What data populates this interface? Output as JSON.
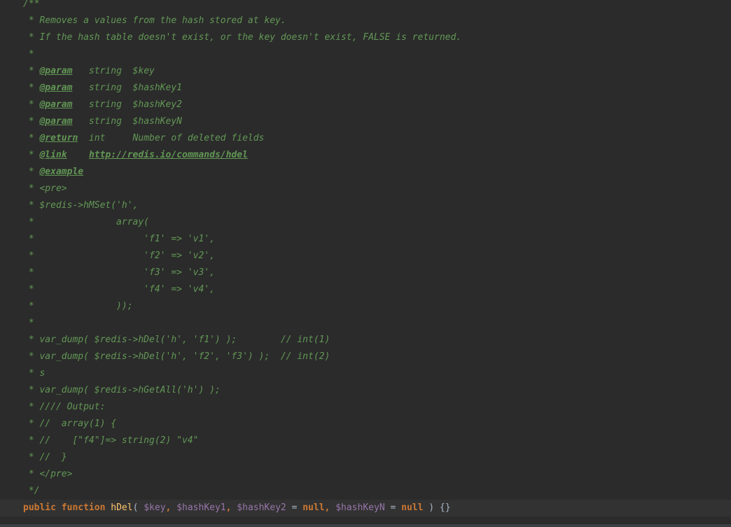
{
  "editor": {
    "lines": [
      [
        {
          "c": "t-comment",
          "t": "/**"
        }
      ],
      [
        {
          "c": "t-comment",
          "t": " * Removes a values from the hash stored at key."
        }
      ],
      [
        {
          "c": "t-comment",
          "t": " * If the hash table doesn't exist, or the key doesn't exist, FALSE is returned."
        }
      ],
      [
        {
          "c": "t-comment",
          "t": " *"
        }
      ],
      [
        {
          "c": "t-comment",
          "t": " * "
        },
        {
          "c": "t-tag",
          "t": "@param"
        },
        {
          "c": "t-comment",
          "t": "   string  $key"
        }
      ],
      [
        {
          "c": "t-comment",
          "t": " * "
        },
        {
          "c": "t-tag",
          "t": "@param"
        },
        {
          "c": "t-comment",
          "t": "   string  $hashKey1"
        }
      ],
      [
        {
          "c": "t-comment",
          "t": " * "
        },
        {
          "c": "t-tag",
          "t": "@param"
        },
        {
          "c": "t-comment",
          "t": "   string  $hashKey2"
        }
      ],
      [
        {
          "c": "t-comment",
          "t": " * "
        },
        {
          "c": "t-tag",
          "t": "@param"
        },
        {
          "c": "t-comment",
          "t": "   string  $hashKeyN"
        }
      ],
      [
        {
          "c": "t-comment",
          "t": " * "
        },
        {
          "c": "t-tag",
          "t": "@return"
        },
        {
          "c": "t-comment",
          "t": "  int     Number of deleted fields"
        }
      ],
      [
        {
          "c": "t-comment",
          "t": " * "
        },
        {
          "c": "t-tag",
          "t": "@link"
        },
        {
          "c": "t-comment",
          "t": "    "
        },
        {
          "c": "t-link",
          "t": "http://redis.io/commands/hdel"
        }
      ],
      [
        {
          "c": "t-comment",
          "t": " * "
        },
        {
          "c": "t-tag",
          "t": "@example"
        }
      ],
      [
        {
          "c": "t-comment",
          "t": " * <pre>"
        }
      ],
      [
        {
          "c": "t-comment",
          "t": " * $redis->hMSet('h',"
        }
      ],
      [
        {
          "c": "t-comment",
          "t": " *               array("
        }
      ],
      [
        {
          "c": "t-comment",
          "t": " *                    'f1' => 'v1',"
        }
      ],
      [
        {
          "c": "t-comment",
          "t": " *                    'f2' => 'v2',"
        }
      ],
      [
        {
          "c": "t-comment",
          "t": " *                    'f3' => 'v3',"
        }
      ],
      [
        {
          "c": "t-comment",
          "t": " *                    'f4' => 'v4',"
        }
      ],
      [
        {
          "c": "t-comment",
          "t": " *               ));"
        }
      ],
      [
        {
          "c": "t-comment",
          "t": " *"
        }
      ],
      [
        {
          "c": "t-comment",
          "t": " * var_dump( $redis->hDel('h', 'f1') );        // int(1)"
        }
      ],
      [
        {
          "c": "t-comment",
          "t": " * var_dump( $redis->hDel('h', 'f2', 'f3') );  // int(2)"
        }
      ],
      [
        {
          "c": "t-comment",
          "t": " * s"
        }
      ],
      [
        {
          "c": "t-comment",
          "t": " * var_dump( $redis->hGetAll('h') );"
        }
      ],
      [
        {
          "c": "t-comment",
          "t": " * //// Output:"
        }
      ],
      [
        {
          "c": "t-comment",
          "t": " * //  array(1) {"
        }
      ],
      [
        {
          "c": "t-comment",
          "t": " * //    [\"f4\"]=> string(2) \"v4\""
        }
      ],
      [
        {
          "c": "t-comment",
          "t": " * //  }"
        }
      ],
      [
        {
          "c": "t-comment",
          "t": " * </pre>"
        }
      ],
      [
        {
          "c": "t-comment",
          "t": " */"
        }
      ],
      [
        {
          "c": "t-kw",
          "t": "public"
        },
        {
          "c": "t-punc",
          "t": " "
        },
        {
          "c": "t-kw",
          "t": "function"
        },
        {
          "c": "t-punc",
          "t": " "
        },
        {
          "c": "t-fn",
          "t": "hDel"
        },
        {
          "c": "t-punc",
          "t": "( "
        },
        {
          "c": "t-var",
          "t": "$key"
        },
        {
          "c": "t-kw",
          "t": ","
        },
        {
          "c": "t-punc",
          "t": " "
        },
        {
          "c": "t-var",
          "t": "$hashKey1"
        },
        {
          "c": "t-kw",
          "t": ","
        },
        {
          "c": "t-punc",
          "t": " "
        },
        {
          "c": "t-var",
          "t": "$hashKey2"
        },
        {
          "c": "t-punc",
          "t": " = "
        },
        {
          "c": "t-kw",
          "t": "null"
        },
        {
          "c": "t-kw",
          "t": ","
        },
        {
          "c": "t-punc",
          "t": " "
        },
        {
          "c": "t-var",
          "t": "$hashKeyN"
        },
        {
          "c": "t-punc",
          "t": " = "
        },
        {
          "c": "t-kw",
          "t": "null"
        },
        {
          "c": "t-punc",
          "t": " ) {}"
        }
      ]
    ],
    "current_line_index": 30
  }
}
